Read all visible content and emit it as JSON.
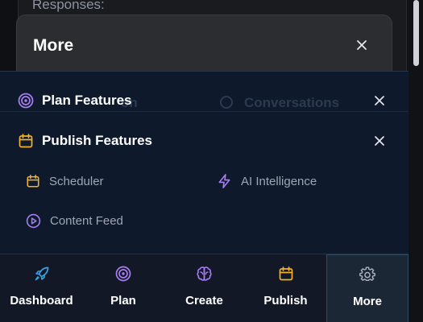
{
  "background": {
    "label": "Responses:"
  },
  "more_dialog": {
    "title": "More"
  },
  "features": {
    "plan": {
      "title": "Plan Features",
      "ghost_left": "on",
      "ghost_right": "Conversations"
    },
    "publish": {
      "title": "Publish Features",
      "items": [
        {
          "label": "Scheduler",
          "icon": "calendar-icon"
        },
        {
          "label": "AI Intelligence",
          "icon": "lightning-icon"
        },
        {
          "label": "Content Feed",
          "icon": "play-circle-icon"
        }
      ]
    }
  },
  "nav": {
    "items": [
      {
        "label": "Dashboard",
        "icon": "rocket-icon"
      },
      {
        "label": "Plan",
        "icon": "target-icon"
      },
      {
        "label": "Create",
        "icon": "brain-icon"
      },
      {
        "label": "Publish",
        "icon": "calendar-icon"
      },
      {
        "label": "More",
        "icon": "gear-icon"
      }
    ],
    "active": "More"
  },
  "colors": {
    "accent_purple": "#a77cf0",
    "accent_orange": "#f3b12c",
    "accent_blue": "#35a4e6",
    "panel_bg": "#0e1a2b"
  }
}
